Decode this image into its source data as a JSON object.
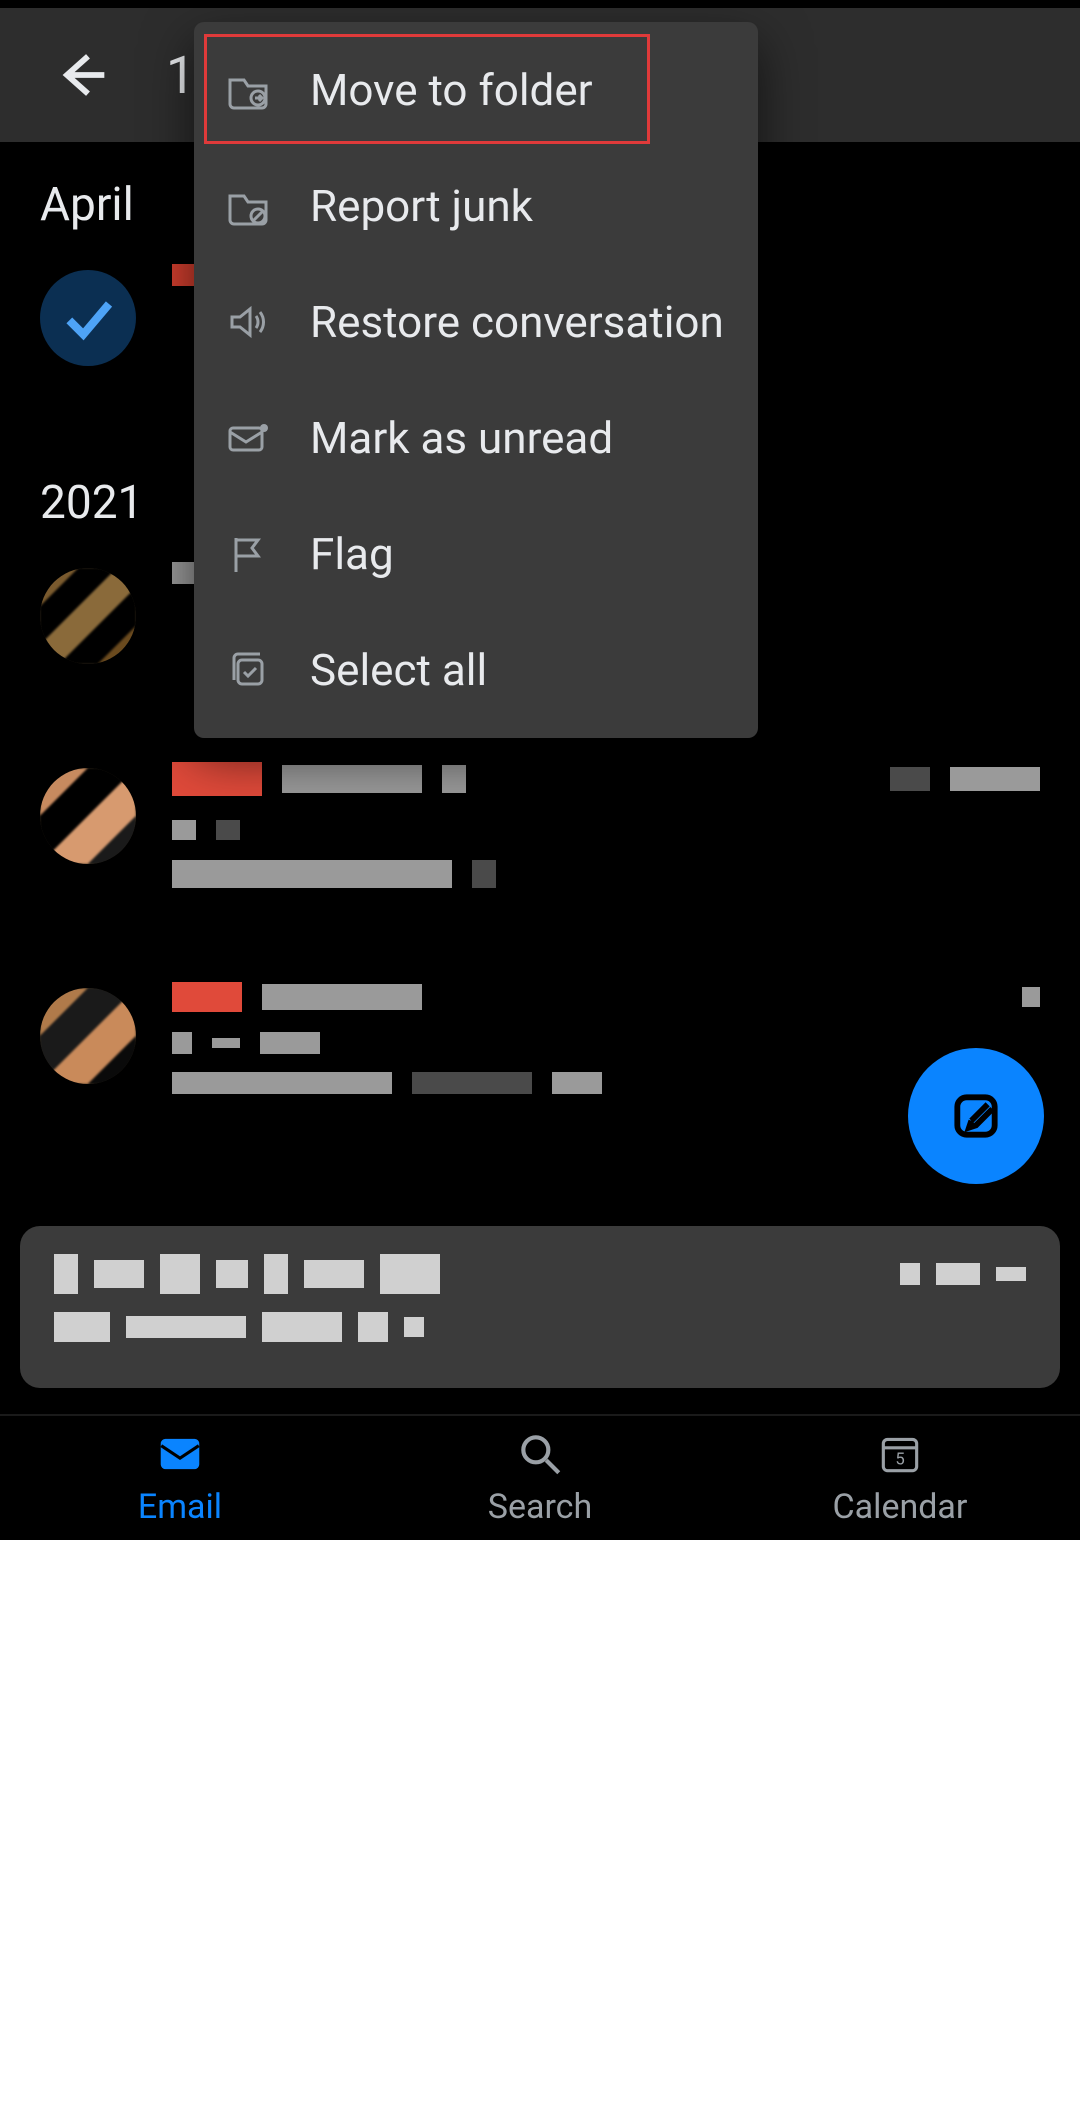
{
  "header": {
    "selected_count": "1"
  },
  "menu": {
    "items": [
      {
        "label": "Move to folder",
        "icon": "folder-move-icon"
      },
      {
        "label": "Report junk",
        "icon": "folder-block-icon"
      },
      {
        "label": "Restore conversation",
        "icon": "speaker-icon"
      },
      {
        "label": "Mark as unread",
        "icon": "mail-unread-icon"
      },
      {
        "label": "Flag",
        "icon": "flag-icon"
      },
      {
        "label": "Select all",
        "icon": "select-all-icon"
      }
    ],
    "highlighted_index": 0
  },
  "sections": [
    {
      "label": "April"
    },
    {
      "label": "2021"
    }
  ],
  "bottom_nav": {
    "items": [
      {
        "label": "Email",
        "icon": "mail-icon",
        "active": true
      },
      {
        "label": "Search",
        "icon": "search-icon",
        "active": false
      },
      {
        "label": "Calendar",
        "icon": "calendar-icon",
        "active": false,
        "badge": "5"
      }
    ]
  }
}
